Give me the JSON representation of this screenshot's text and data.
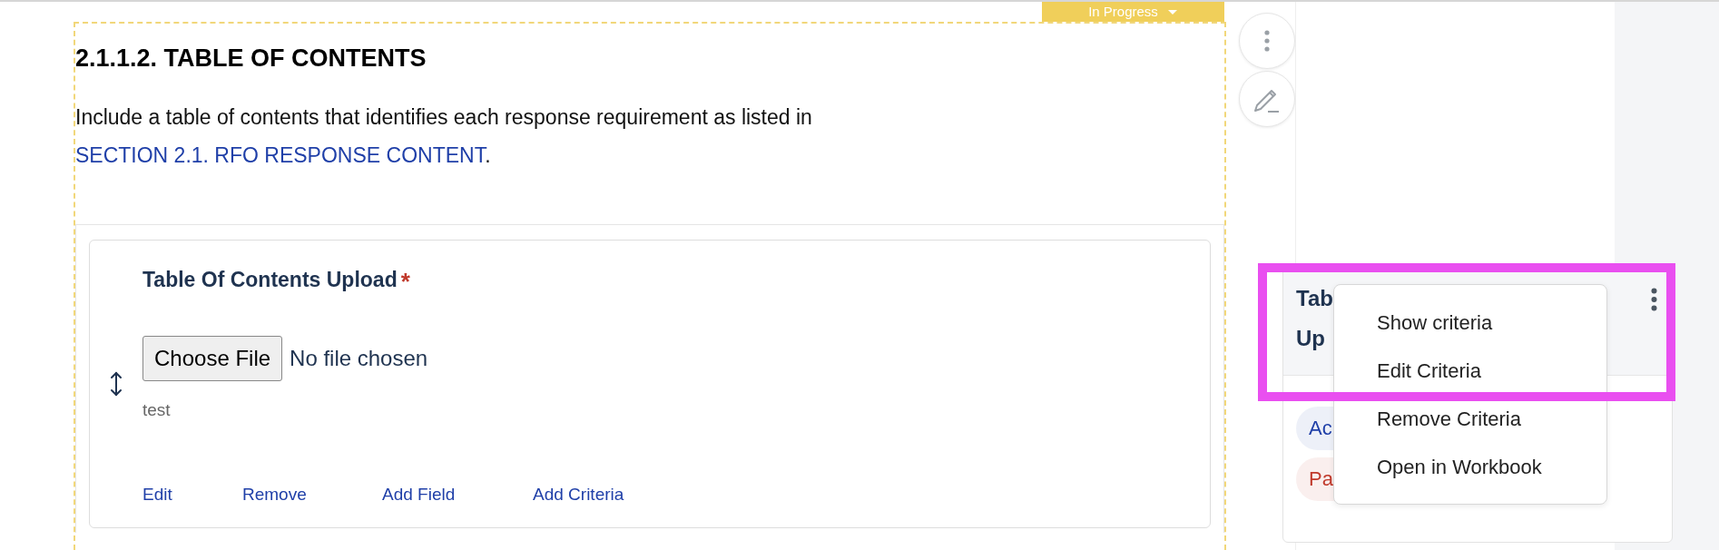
{
  "status_badge": {
    "label": "In Progress"
  },
  "section": {
    "heading": "2.1.1.2. TABLE OF CONTENTS",
    "intro": "Include a table of contents that identifies each response requirement as listed in",
    "link": "SECTION 2.1. RFO RESPONSE CONTENT",
    "trailing": "."
  },
  "field": {
    "title": "Table Of Contents Upload",
    "required_mark": "*",
    "button": "Choose File",
    "file_status": "No file chosen",
    "description": "test",
    "actions": [
      "Edit",
      "Remove",
      "Add Field",
      "Add Criteria"
    ]
  },
  "side_card": {
    "title_lines": [
      "Tab",
      "Up"
    ],
    "chips": [
      {
        "label": "Ac",
        "color": "#1f3fa8"
      },
      {
        "label": "Pa",
        "color": "#c0392b"
      }
    ]
  },
  "menu": {
    "items": [
      "Show criteria",
      "Edit Criteria",
      "Remove Criteria",
      "Open in Workbook"
    ]
  }
}
